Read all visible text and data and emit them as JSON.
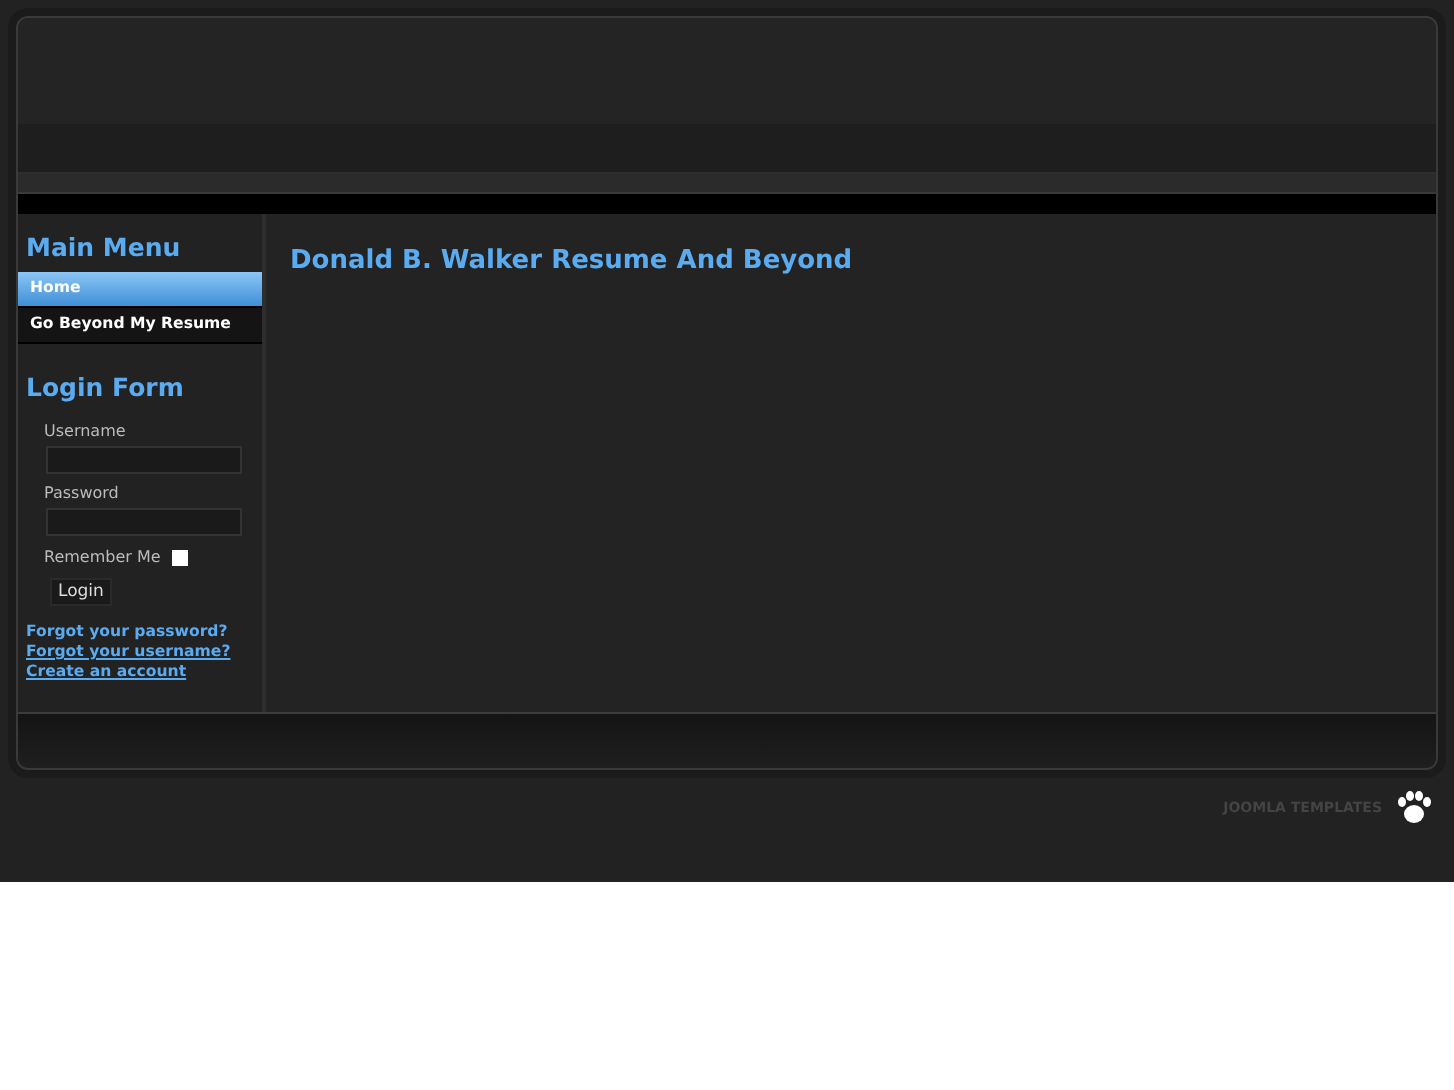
{
  "main_menu": {
    "title": "Main Menu",
    "items": [
      {
        "label": "Home",
        "selected": true
      },
      {
        "label": "Go Beyond My Resume",
        "selected": false
      }
    ]
  },
  "login_form": {
    "title": "Login Form",
    "username_label": "Username",
    "password_label": "Password",
    "remember_label": "Remember Me",
    "remember_checked": false,
    "login_button": "Login",
    "links": [
      "Forgot your password?",
      "Forgot your username?",
      "Create an account"
    ]
  },
  "article": {
    "title": "Donald B. Walker Resume And Beyond"
  },
  "footer": {
    "credit": "JOOMLA TEMPLATES"
  }
}
